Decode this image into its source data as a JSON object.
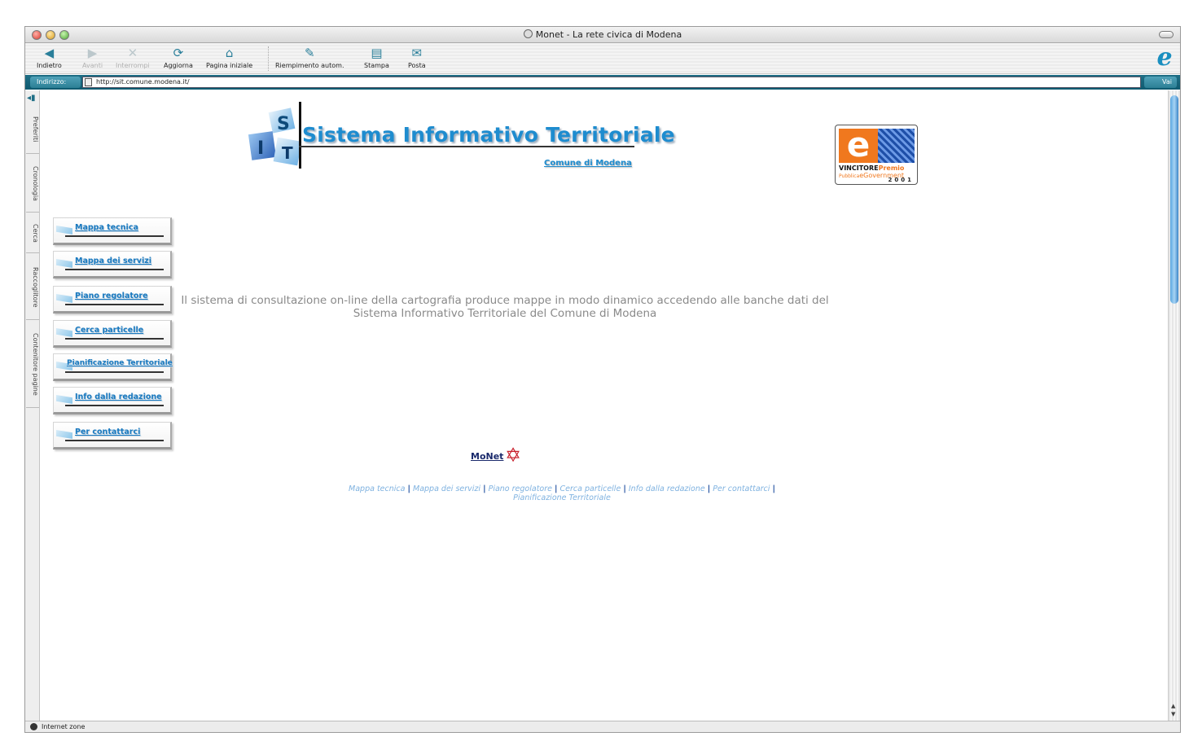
{
  "window": {
    "title": "Monet - La rete civica di Modena"
  },
  "toolbar": {
    "back": "Indietro",
    "forward": "Avanti",
    "stop": "Interrompi",
    "refresh": "Aggiorna",
    "home": "Pagina iniziale",
    "autofill": "Riempimento autom.",
    "print": "Stampa",
    "mail": "Posta"
  },
  "address": {
    "label": "Indirizzo:",
    "url": "http://sit.comune.modena.it/",
    "go": "Vai"
  },
  "sidetabs": [
    "Preferiti",
    "Cronologia",
    "Cerca",
    "Raccoglitore",
    "Contenitore pagine"
  ],
  "header": {
    "logo_letters": [
      "S",
      "I",
      "T"
    ],
    "title": "Sistema Informativo Territoriale",
    "subtitle": "Comune di Modena"
  },
  "award": {
    "letter": "e",
    "winner": "VINCITORE",
    "premio": "Premio",
    "prefix": "Pubblica",
    "egov": "eGovernment",
    "year": "2001"
  },
  "nav": [
    "Mappa tecnica",
    "Mappa dei servizi",
    "Piano regolatore",
    "Cerca particelle",
    "Pianificazione Territoriale",
    "Info dalla redazione",
    "Per contattarci"
  ],
  "intro": "Il sistema di consultazione on-line della cartografia produce mappe in modo dinamico accedendo alle banche dati del Sistema Informativo Territoriale del Comune di Modena",
  "brand": {
    "name": "MoNet",
    "star": "✡"
  },
  "footer_links": [
    "Mappa tecnica",
    "Mappa dei servizi",
    "Piano regolatore",
    "Cerca particelle",
    "Info dalla redazione",
    "Per contattarci",
    "Pianificazione Territoriale"
  ],
  "status": {
    "zone": "Internet zone"
  },
  "colors": {
    "accent": "#1e8ccf",
    "address_bar": "#1f6f86",
    "award_orange": "#f0781e"
  }
}
